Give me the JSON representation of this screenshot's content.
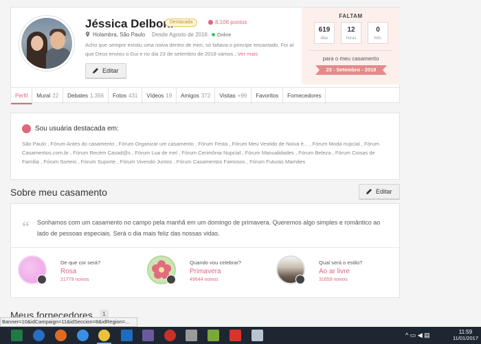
{
  "profile": {
    "name": "Jéssica Delboni",
    "badge": "Destacada",
    "points": "8.106 pontos",
    "location": "Holambra, São Paulo",
    "since": "Desde Agosto de 2016",
    "status": "Online",
    "bio": "Acho que sempre existiu uma noiva dentro de mim, só faltava o principe encantado. Foi aí que Deus enviou o Gui e no dia 23 de setembro de 2018 vamos...",
    "bio_more": "Ver mais",
    "edit_label": "Editar"
  },
  "countdown": {
    "title": "FALTAM",
    "days": "619",
    "days_label": "dias",
    "hours": "12",
    "hours_label": "horas",
    "minutes": "0",
    "minutes_label": "min.",
    "subtitle": "para o meu casamento",
    "date": "23 - Setembro - 2018"
  },
  "tabs": [
    {
      "label": "Perfil",
      "count": ""
    },
    {
      "label": "Mural",
      "count": "22"
    },
    {
      "label": "Debates",
      "count": "1.356"
    },
    {
      "label": "Fotos",
      "count": "431"
    },
    {
      "label": "Vídeos",
      "count": "19"
    },
    {
      "label": "Amigos",
      "count": "372"
    },
    {
      "label": "Visitas",
      "count": "+99"
    },
    {
      "label": "Favoritos",
      "count": ""
    },
    {
      "label": "Fornecedores",
      "count": ""
    }
  ],
  "featured": {
    "title": "Sou usuária destacada em:",
    "forums": "São Paulo , Fórum Antes do casamento , Fórum Organizar um casamento , Fórum Festa , Fórum Meu Vestido de Noiva é... , Fórum Moda nupcial , Fórum Casamentos.com.br , Fórum Recém Casad@s , Fórum Lua de mel , Fórum Cerimônia Nupcial , Fórum Manualidades , Fórum Beleza , Fórum Coisas de Família , Fórum Sorteio , Fórum Suporte , Fórum Vivendo Juntos , Fórum Casamentos Famosos , Fórum Futuras Mamães"
  },
  "wedding": {
    "section_title": "Sobre meu casamento",
    "edit_label": "Editar",
    "text": "Sonhamos com um casamento no campo pela manhã em um domingo de primavera. Queremos algo simples e romântico ao lado de pessoas especiais. Será o dia mais feliz das nossas vidas.",
    "questions": [
      {
        "question": "De que cor será?",
        "answer": "Rosa",
        "count": "21779 noivos"
      },
      {
        "question": "Quando vou celebrar?",
        "answer": "Primavera",
        "count": "49644 noivos"
      },
      {
        "question": "Qual será o estilo?",
        "answer": "Ao ar livre",
        "count": "31659 noivos"
      }
    ]
  },
  "providers": {
    "title": "Meus fornecedores",
    "count": "1"
  },
  "statusbar": {
    "url": "Banner=10&idCampaign=11&idSeccion=8&idRegion=..."
  },
  "taskbar": {
    "time": "11:59",
    "date": "11/01/2017"
  },
  "colors": {
    "accent": "#e0677a",
    "countdown_bg": "#fdf0ec",
    "badge_gold": "#e6c25a"
  }
}
